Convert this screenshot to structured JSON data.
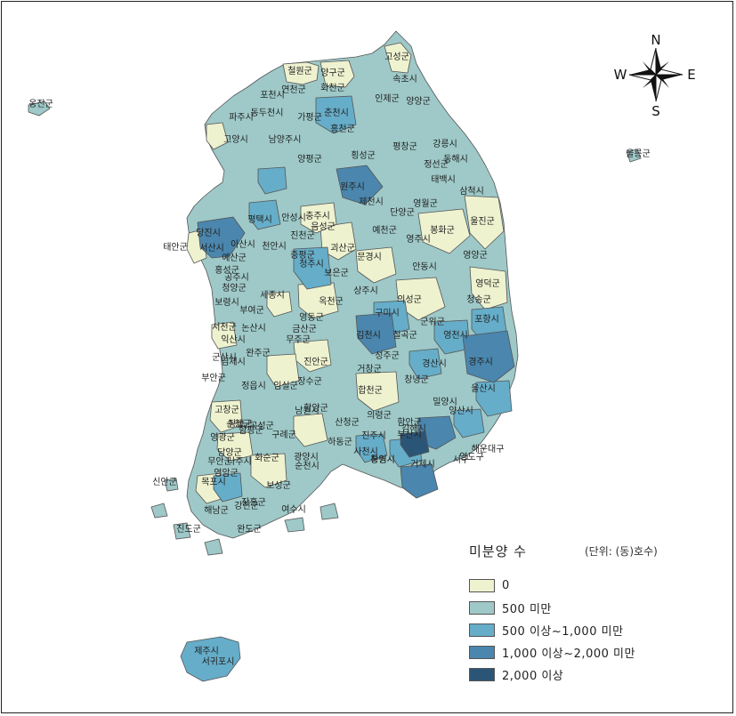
{
  "compass": {
    "n": "N",
    "s": "S",
    "e": "E",
    "w": "W"
  },
  "legend": {
    "title": "미분양 수",
    "unit": "(단위: (동)호수)",
    "classes": [
      {
        "label": "0",
        "color": "#eef2cf"
      },
      {
        "label": "500 미만",
        "color": "#9ec9c8"
      },
      {
        "label": "500 이상~1,000 미만",
        "color": "#66adc9"
      },
      {
        "label": "1,000 이상~2,000 미만",
        "color": "#4a86ad"
      },
      {
        "label": "2,000 이상",
        "color": "#2b5577"
      }
    ]
  },
  "map": {
    "outline_color": "#555555",
    "labels": [
      "철원군",
      "양구군",
      "고성군",
      "화천군",
      "인제군",
      "연천군",
      "포천시",
      "양양군",
      "춘천시",
      "파주시",
      "가평군",
      "속초시",
      "강릉시",
      "홍천군",
      "동두천시",
      "남양주시",
      "평창군",
      "횡성군",
      "정선군",
      "고양시",
      "양평군",
      "원주시",
      "삼척시",
      "동해시",
      "충주시",
      "제천시",
      "단양군",
      "영월군",
      "태백시",
      "울진군",
      "봉화군",
      "당진시",
      "평택시",
      "안성시",
      "진천군",
      "음성군",
      "괴산군",
      "천안시",
      "서산시",
      "아산시",
      "태안군",
      "예산군",
      "홍성군",
      "청주시",
      "증평군",
      "보은군",
      "문경시",
      "영주시",
      "예천군",
      "안동시",
      "영양군",
      "영덕군",
      "청양군",
      "공주시",
      "세종시",
      "상주시",
      "의성군",
      "청송군",
      "보령시",
      "부여군",
      "논산시",
      "옥천군",
      "영동군",
      "김천시",
      "구미시",
      "군위군",
      "포항시",
      "서천군",
      "익산시",
      "금산군",
      "칠곡군",
      "영천시",
      "군산시",
      "완주군",
      "무주군",
      "성주군",
      "경산시",
      "경주시",
      "김제시",
      "진안군",
      "거창군",
      "부안군",
      "정읍시",
      "임실군",
      "장수군",
      "고창군",
      "순창군",
      "함양군",
      "합천군",
      "창녕군",
      "밀양시",
      "울산시",
      "양산시",
      "남원시",
      "산청군",
      "의령군",
      "함안군",
      "김해시",
      "부산시",
      "곡성군",
      "구례군",
      "하동군",
      "진주시",
      "창원시",
      "담양군",
      "광양시",
      "사천시",
      "통영시",
      "거제시",
      "영암군",
      "강진군",
      "장흥군",
      "보성군",
      "순천시",
      "여수시",
      "해남군",
      "완도군",
      "진도군",
      "신안군",
      "목포시",
      "무안군",
      "나주시",
      "화순군",
      "함평군",
      "영광군",
      "장성군",
      "해운대구",
      "영도구",
      "서구",
      "제주시",
      "서귀포시",
      "옹진군",
      "울릉군"
    ]
  }
}
